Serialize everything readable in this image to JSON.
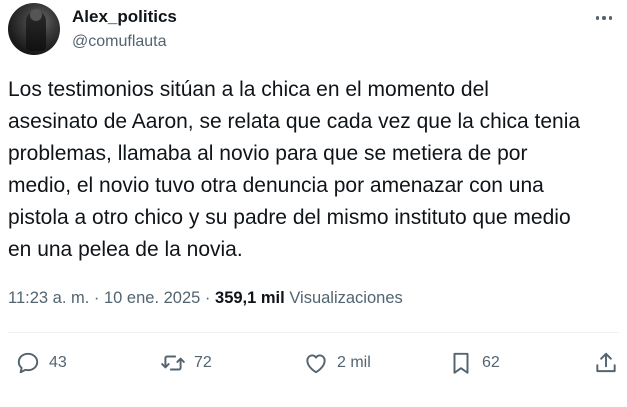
{
  "author": {
    "display_name": "Alex_politics",
    "handle": "@comuflauta",
    "avatar_icon": "profile-photo"
  },
  "tweet": {
    "lines": [
      "Los testimonios sitúan a la chica en el momento del",
      "asesinato de Aaron, se relata que cada vez que la chica tenia",
      "problemas, llamaba al novio para que se metiera de por",
      "medio, el novio tuvo otra denuncia por amenazar con una",
      "pistola a otro chico y su padre del mismo instituto que medio",
      "en una pelea de la novia."
    ]
  },
  "meta": {
    "time": "11:23 a. m.",
    "separator": " · ",
    "date": "10 ene. 2025",
    "views_count": "359,1 mil",
    "views_label": " Visualizaciones"
  },
  "actions": {
    "replies": "43",
    "reposts": "72",
    "likes": "2 mil",
    "bookmarks": "62"
  },
  "colors": {
    "text": "#0f1419",
    "secondary": "#536471",
    "divider": "#eff3f4"
  },
  "icons": [
    "more-icon",
    "reply-icon",
    "repost-icon",
    "like-icon",
    "bookmark-icon",
    "share-icon"
  ]
}
